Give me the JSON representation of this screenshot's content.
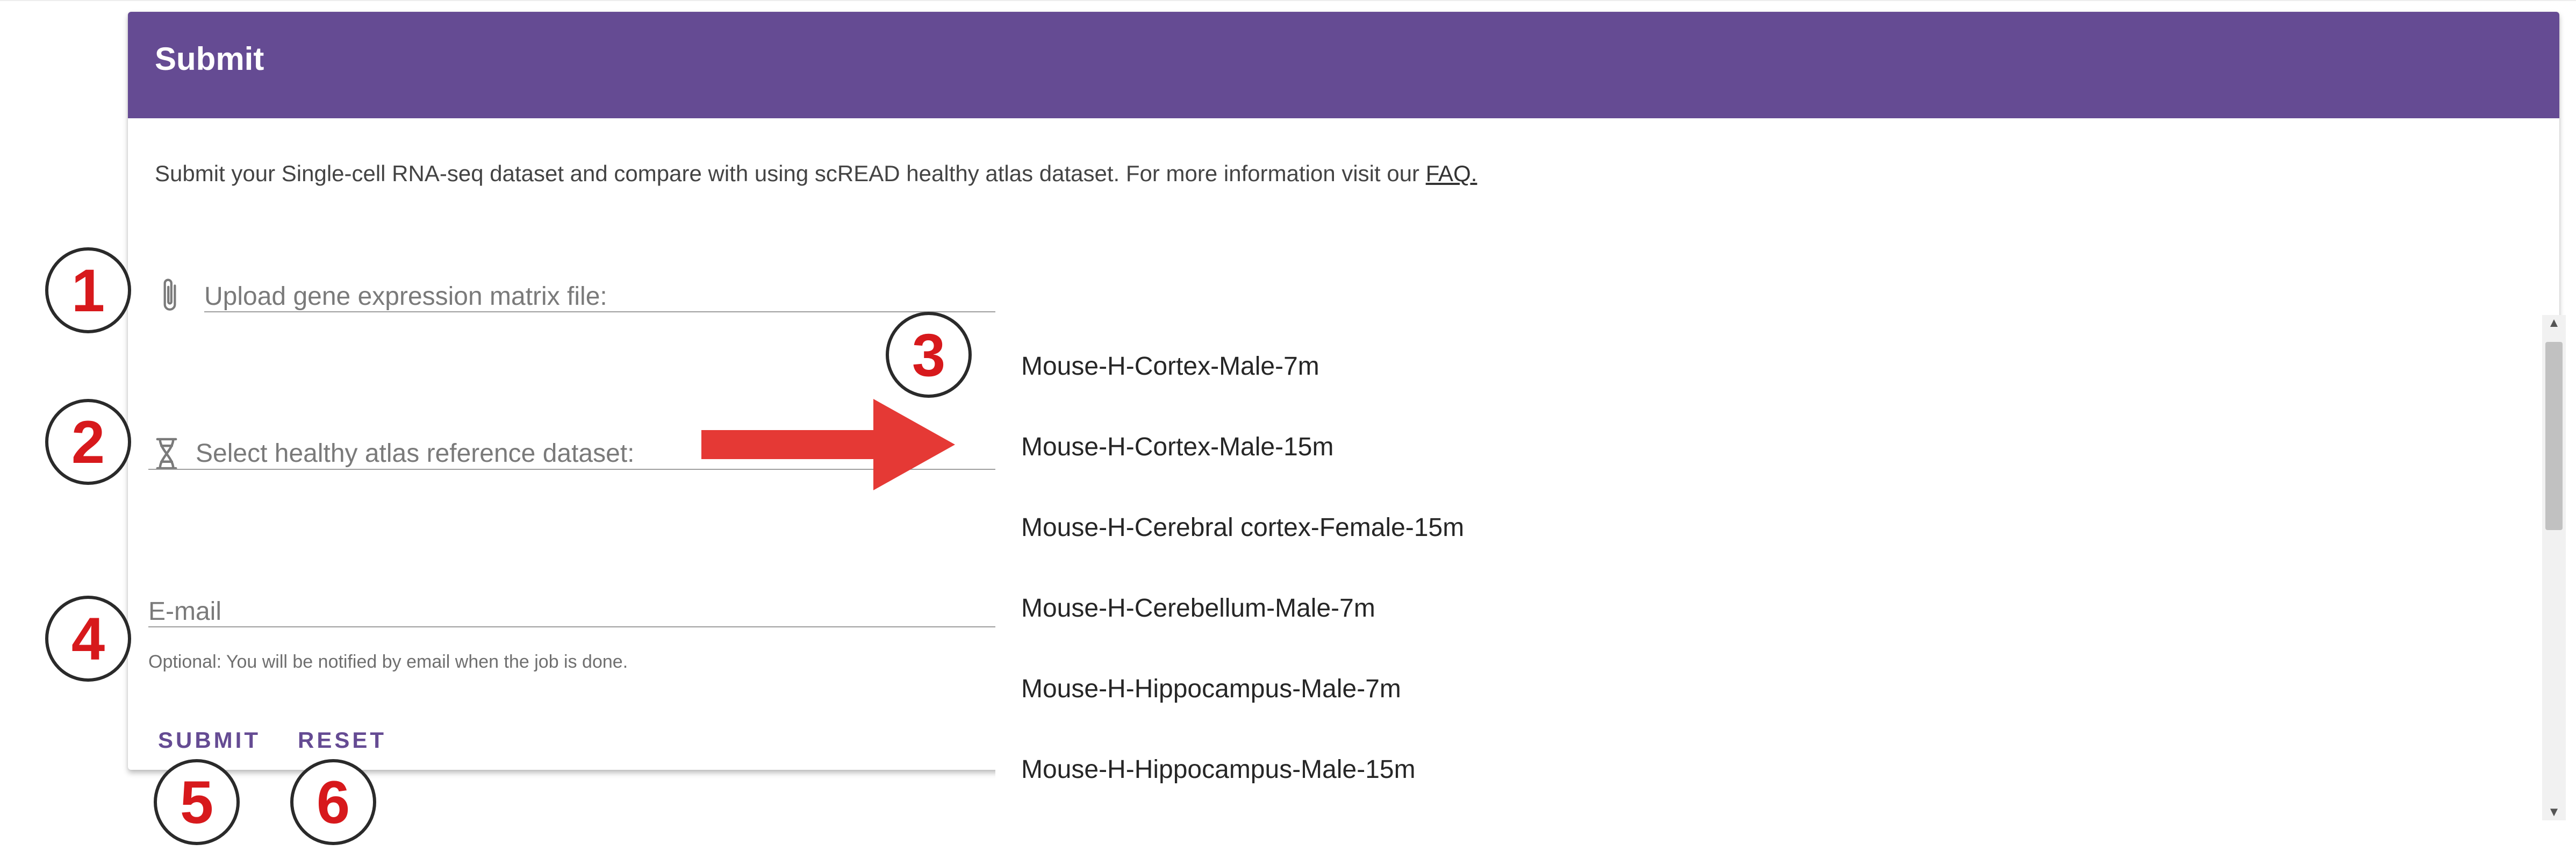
{
  "header": {
    "title": "Submit"
  },
  "intro": {
    "text": "Submit your Single-cell RNA-seq dataset and compare with using scREAD healthy atlas dataset. For more information visit our ",
    "link": "FAQ."
  },
  "form": {
    "upload_label": "Upload gene expression matrix file:",
    "dataset_label": "Select healthy atlas reference dataset:",
    "email_placeholder": "E-mail",
    "email_hint": "Optional: You will be notified by email when the job is done.",
    "submit_label": "SUBMIT",
    "reset_label": "RESET"
  },
  "dataset_options": [
    "Mouse-H-Cortex-Male-7m",
    "Mouse-H-Cortex-Male-15m",
    "Mouse-H-Cerebral cortex-Female-15m",
    "Mouse-H-Cerebellum-Male-7m",
    "Mouse-H-Hippocampus-Male-7m",
    "Mouse-H-Hippocampus-Male-15m"
  ],
  "annotations": [
    "1",
    "2",
    "3",
    "4",
    "5",
    "6"
  ],
  "icons": {
    "upload": "paperclip-icon",
    "dataset": "dna-icon",
    "arrow": "red-arrow-icon"
  },
  "colors": {
    "header": "#654b93",
    "button_text": "#654b93",
    "annotation_number": "#d7191c",
    "arrow": "#e53935"
  }
}
